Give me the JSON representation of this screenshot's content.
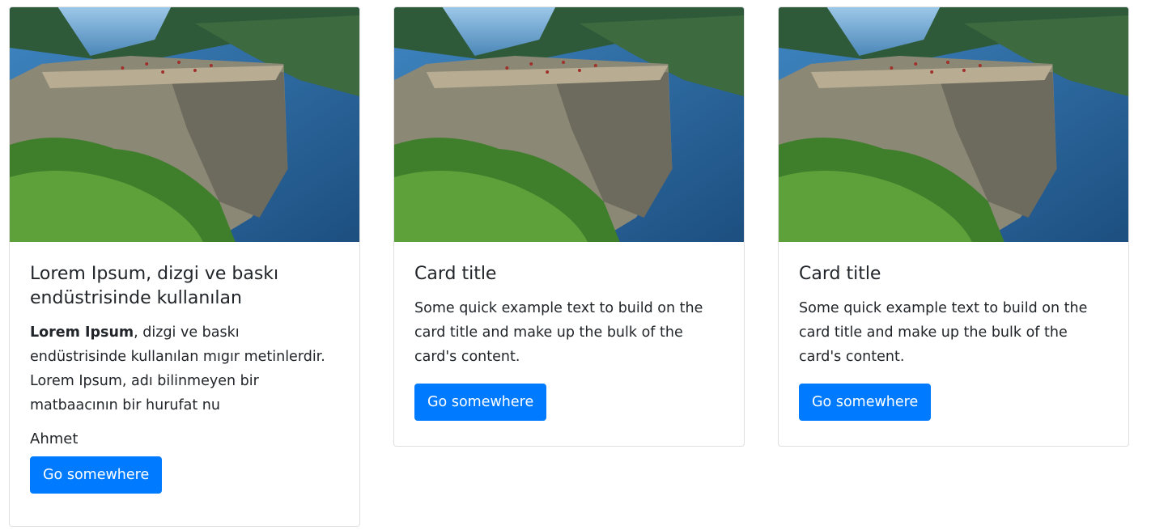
{
  "cards": [
    {
      "title": "Lorem Ipsum, dizgi ve baskı endüstrisinde kullanılan",
      "text_bold": "Lorem Ipsum",
      "text_rest": ", dizgi ve baskı endüstrisinde kullanılan mıgır metinlerdir. Lorem Ipsum, adı bilinmeyen bir matbaacının bir hurufat nu",
      "author": "Ahmet",
      "button": "Go somewhere"
    },
    {
      "title": "Card title",
      "text": "Some quick example text to build on the card title and make up the bulk of the card's content.",
      "button": "Go somewhere"
    },
    {
      "title": "Card title",
      "text": "Some quick example text to build on the card title and make up the bulk of the card's content.",
      "button": "Go somewhere"
    }
  ],
  "colors": {
    "button_bg": "#007bff",
    "button_text": "#ffffff"
  }
}
